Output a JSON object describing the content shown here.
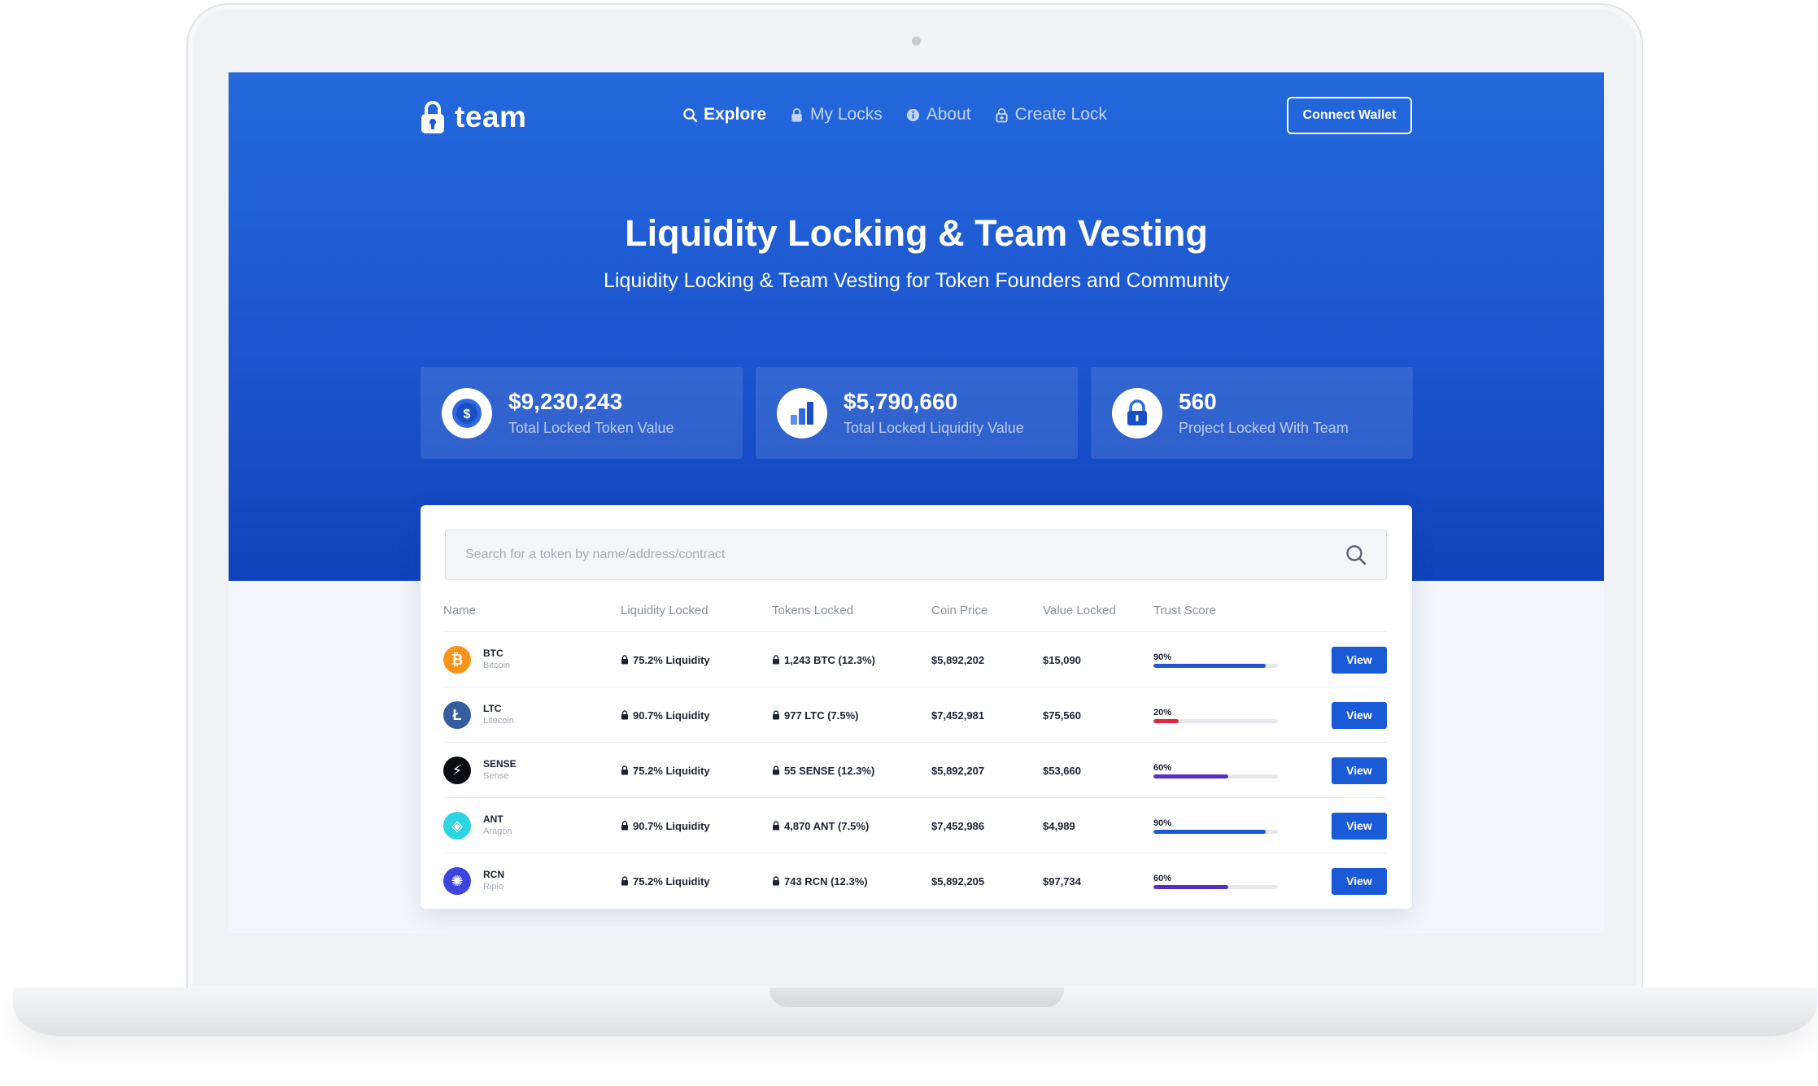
{
  "app": {
    "logo_text": "team"
  },
  "nav": {
    "items": [
      {
        "label": "Explore",
        "icon": "search-icon",
        "active": true
      },
      {
        "label": "My Locks",
        "icon": "lock-icon",
        "active": false
      },
      {
        "label": "About",
        "icon": "info-icon",
        "active": false
      },
      {
        "label": "Create Lock",
        "icon": "lock-plus-icon",
        "active": false
      }
    ],
    "connect_label": "Connect Wallet"
  },
  "hero": {
    "title": "Liquidity Locking & Team Vesting",
    "subtitle": "Liquidity Locking & Team Vesting for Token Founders and Community"
  },
  "stats": [
    {
      "value": "$9,230,243",
      "label": "Total Locked Token Value",
      "icon": "dollar-coin-icon"
    },
    {
      "value": "$5,790,660",
      "label": "Total Locked Liquidity Value",
      "icon": "bar-chart-icon"
    },
    {
      "value": "560",
      "label": "Project Locked With Team",
      "icon": "padlock-icon"
    }
  ],
  "search": {
    "placeholder": "Search for a token by name/address/contract"
  },
  "table": {
    "headers": [
      "Name",
      "Liquidity Locked",
      "Tokens Locked",
      "Coin Price",
      "Value Locked",
      "Trust Score"
    ],
    "rows": [
      {
        "symbol": "BTC",
        "name": "Bitcoin",
        "liquidity": "75.2% Liquidity",
        "tokens": "1,243 BTC (12.3%)",
        "price": "$5,892,202",
        "value": "$15,090",
        "trust_label": "90%",
        "trust": 0.9,
        "trust_color": "#1f56d4",
        "logo_color": "#f7931a",
        "logo_glyph": "₿",
        "action": "View"
      },
      {
        "symbol": "LTC",
        "name": "Litecoin",
        "liquidity": "90.7% Liquidity",
        "tokens": "977 LTC (7.5%)",
        "price": "$7,452,981",
        "value": "$75,560",
        "trust_label": "20%",
        "trust": 0.2,
        "trust_color": "#e0283c",
        "logo_color": "#345d9d",
        "logo_glyph": "Ł",
        "action": "View"
      },
      {
        "symbol": "SENSE",
        "name": "Sense",
        "liquidity": "75.2% Liquidity",
        "tokens": "55 SENSE (12.3%)",
        "price": "$5,892,207",
        "value": "$53,660",
        "trust_label": "60%",
        "trust": 0.6,
        "trust_color": "#5a2fbf",
        "logo_color": "#0b0b12",
        "logo_glyph": "⚡",
        "action": "View"
      },
      {
        "symbol": "ANT",
        "name": "Aragon",
        "liquidity": "90.7% Liquidity",
        "tokens": "4,870 ANT (7.5%)",
        "price": "$7,452,986",
        "value": "$4,989",
        "trust_label": "90%",
        "trust": 0.9,
        "trust_color": "#1f56d4",
        "logo_color": "#2cd3e1",
        "logo_glyph": "◈",
        "action": "View"
      },
      {
        "symbol": "RCN",
        "name": "Ripio",
        "liquidity": "75.2% Liquidity",
        "tokens": "743 RCN (12.3%)",
        "price": "$5,892,205",
        "value": "$97,734",
        "trust_label": "60%",
        "trust": 0.6,
        "trust_color": "#5a2fbf",
        "logo_color": "#3d45e0",
        "logo_glyph": "✺",
        "action": "View"
      }
    ]
  },
  "colors": {
    "primary": "#1a5ad6",
    "hero_top": "#2468dc",
    "hero_bottom": "#0f43bb",
    "page_bg": "#f3f6fa"
  }
}
